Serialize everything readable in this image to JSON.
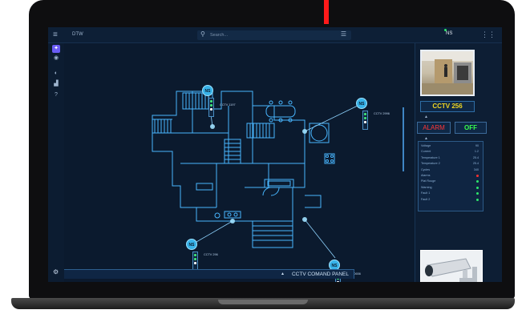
{
  "topbar": {
    "title": "DTW",
    "search_placeholder": "Search...",
    "user_initials": "NS"
  },
  "map": {
    "cameras": [
      {
        "badge": "NS",
        "label": "CCTV 1197"
      },
      {
        "badge": "NS",
        "label": "CCTV 2996"
      },
      {
        "badge": "NS",
        "label": "CCTV 296"
      },
      {
        "badge": "NS",
        "label": "CCTV 0656"
      }
    ]
  },
  "command_panel": {
    "label": "CCTV COMAND PANEL"
  },
  "right_panel": {
    "camera_title": "CCTV 256",
    "alarm_label": "ALARM",
    "off_label": "OFF",
    "status_rows": [
      {
        "name": "Voltage",
        "value": "90",
        "type": "value"
      },
      {
        "name": "Current",
        "value": "1.2",
        "type": "value"
      },
      {
        "name": "Temperature 1",
        "value": "25.4",
        "type": "value"
      },
      {
        "name": "Temperature 2",
        "value": "25.4",
        "type": "value"
      },
      {
        "name": "Cycles",
        "value": "340",
        "type": "value"
      },
      {
        "name": "Alarms",
        "color": "#ff3030",
        "type": "dot"
      },
      {
        "name": "Plat Rouge",
        "color": "#2ee66b",
        "type": "dot"
      },
      {
        "name": "Warning",
        "color": "#2ee66b",
        "type": "dot"
      },
      {
        "name": "Fault 1",
        "color": "#2ee66b",
        "type": "dot"
      },
      {
        "name": "Fault 2",
        "color": "#2ee66b",
        "type": "dot"
      }
    ]
  },
  "colors": {
    "screen_bg": "#0b1a2e",
    "accent": "#37b2e8",
    "alarm": "#ff3535",
    "ok": "#37ff4d",
    "title_yellow": "#f0d722"
  }
}
